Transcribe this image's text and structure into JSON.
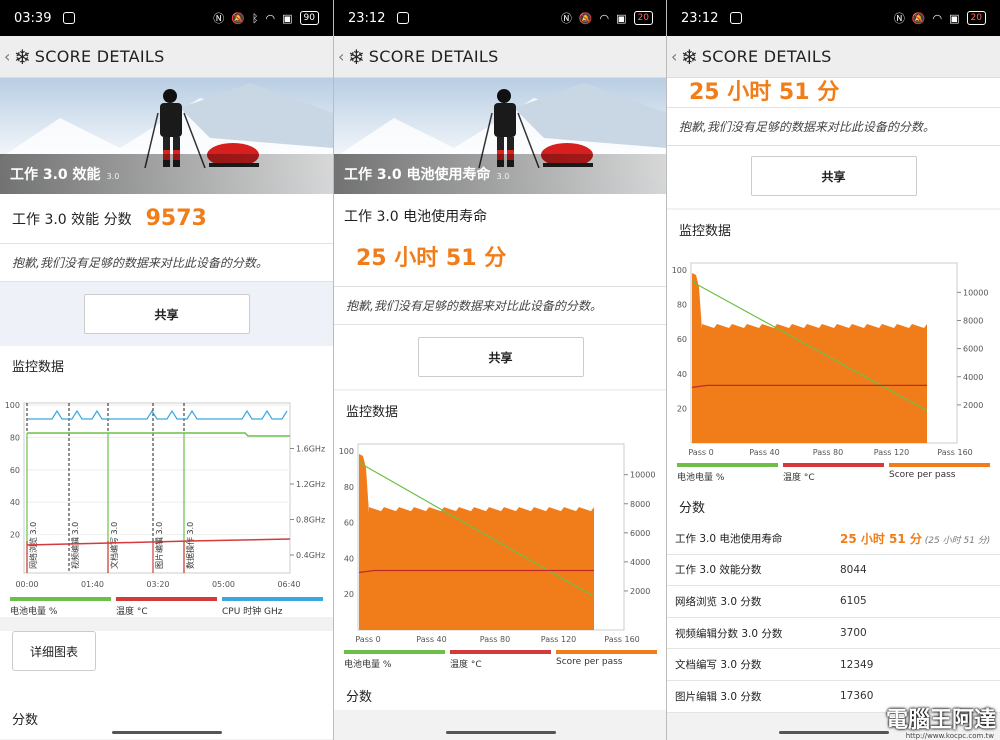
{
  "screens": [
    {
      "status": {
        "time": "03:39",
        "battery": "90"
      },
      "appbar": {
        "title": "SCORE DETAILS"
      },
      "hero": {
        "caption": "工作 3.0 效能",
        "version": "3.0"
      },
      "score": {
        "label": "工作 3.0 效能 分数",
        "value": "9573"
      },
      "notice": "抱歉,我们没有足够的数据来对比此设备的分数。",
      "share_label": "共享",
      "monitor_title": "监控数据",
      "chart": {
        "type": "line",
        "y_left_ticks": [
          "20",
          "40",
          "60",
          "80",
          "100"
        ],
        "y_right_ticks": [
          "0.4GHz",
          "0.8GHz",
          "1.2GHz",
          "1.6GHz"
        ],
        "x_ticks": [
          "00:00",
          "01:40",
          "03:20",
          "05:00",
          "06:40"
        ],
        "segments": [
          "网络浏览 3.0",
          "视频编辑 3.0",
          "文档编写 3.0",
          "图片编辑 3.0",
          "数据操作 3.0"
        ]
      },
      "legend": [
        {
          "label": "电池电量 %",
          "color": "#6cc04a"
        },
        {
          "label": "温度 °C",
          "color": "#d43a3a"
        },
        {
          "label": "CPU 时钟 GHz",
          "color": "#3aa8e0"
        }
      ],
      "detail_button": "详细图表",
      "scores_title": "分数"
    },
    {
      "status": {
        "time": "23:12",
        "battery": "20"
      },
      "appbar": {
        "title": "SCORE DETAILS"
      },
      "hero": {
        "caption": "工作 3.0 电池使用寿命",
        "version": "3.0"
      },
      "score": {
        "label": "工作 3.0 电池使用寿命",
        "value": "25 小时 51 分"
      },
      "notice": "抱歉,我们没有足够的数据来对比此设备的分数。",
      "share_label": "共享",
      "monitor_title": "监控数据",
      "chart": {
        "type": "area",
        "y_left_ticks": [
          "20",
          "40",
          "60",
          "80",
          "100"
        ],
        "y_right_ticks": [
          "2000",
          "4000",
          "6000",
          "8000",
          "10000"
        ],
        "x_ticks": [
          "Pass 0",
          "Pass 40",
          "Pass 80",
          "Pass 120",
          "Pass 160"
        ]
      },
      "legend": [
        {
          "label": "电池电量 %",
          "color": "#6cc04a"
        },
        {
          "label": "温度 °C",
          "color": "#d43a3a"
        },
        {
          "label": "Score per pass",
          "color": "#f07d1a"
        }
      ],
      "scores_title": "分数"
    },
    {
      "status": {
        "time": "23:12",
        "battery": "20"
      },
      "appbar": {
        "title": "SCORE DETAILS"
      },
      "score": {
        "value": "25 小时 51 分"
      },
      "notice": "抱歉,我们没有足够的数据来对比此设备的分数。",
      "share_label": "共享",
      "monitor_title": "监控数据",
      "chart": {
        "type": "area",
        "y_left_ticks": [
          "20",
          "40",
          "60",
          "80",
          "100"
        ],
        "y_right_ticks": [
          "2000",
          "4000",
          "6000",
          "8000",
          "10000"
        ],
        "x_ticks": [
          "Pass 0",
          "Pass 40",
          "Pass 80",
          "Pass 120",
          "Pass 160"
        ]
      },
      "legend": [
        {
          "label": "电池电量 %",
          "color": "#6cc04a"
        },
        {
          "label": "温度 °C",
          "color": "#d43a3a"
        },
        {
          "label": "Score per pass",
          "color": "#f07d1a"
        }
      ],
      "scores_title": "分数",
      "scores": [
        {
          "name": "工作 3.0 电池使用寿命",
          "value": "25 小时 51 分",
          "sub": "(25 小时 51 分)"
        },
        {
          "name": "工作 3.0 效能分数",
          "value": "8044"
        },
        {
          "name": "网络浏览 3.0 分数",
          "value": "6105"
        },
        {
          "name": "视频编辑分数 3.0 分数",
          "value": "3700"
        },
        {
          "name": "文档编写 3.0 分数",
          "value": "12349"
        },
        {
          "name": "图片编辑 3.0 分数",
          "value": "17360"
        }
      ]
    }
  ],
  "watermark": {
    "text": "電腦王阿達",
    "url": "http://www.kocpc.com.tw"
  }
}
